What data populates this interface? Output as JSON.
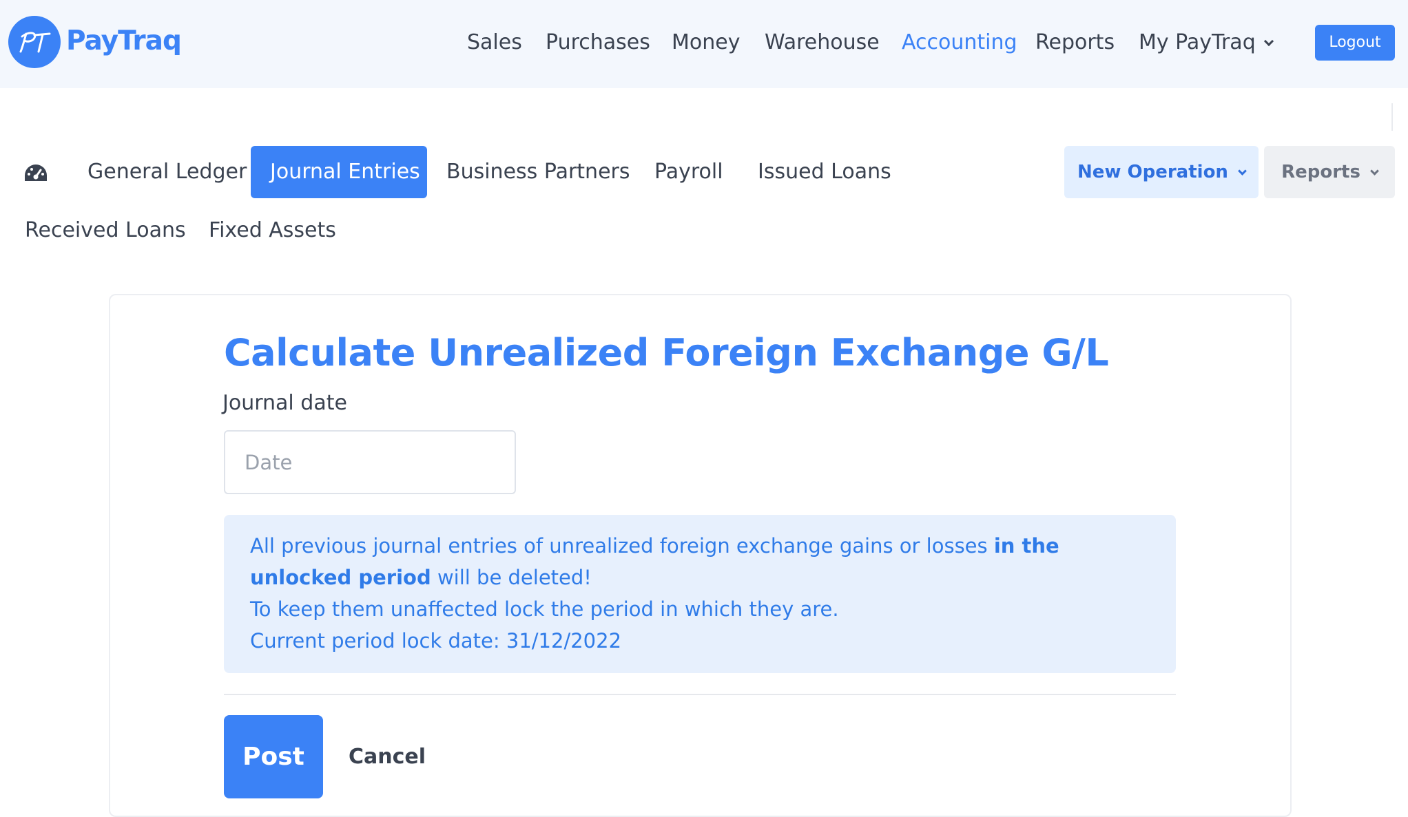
{
  "header": {
    "brand": "PayTraq",
    "logo_mark": "PT",
    "nav": [
      {
        "label": "Sales"
      },
      {
        "label": "Purchases"
      },
      {
        "label": "Money"
      },
      {
        "label": "Warehouse"
      },
      {
        "label": "Accounting",
        "active": true
      },
      {
        "label": "Reports"
      },
      {
        "label": "My PayTraq",
        "dropdown": true
      }
    ],
    "logout_label": "Logout"
  },
  "subnav": {
    "dashboard_icon": "dashboard-gauge-icon",
    "items": [
      {
        "label": "General Ledger"
      },
      {
        "label": "Journal Entries",
        "active": true
      },
      {
        "label": "Business Partners"
      },
      {
        "label": "Payroll"
      },
      {
        "label": "Issued Loans"
      },
      {
        "label": "Received Loans"
      },
      {
        "label": "Fixed Assets"
      }
    ],
    "new_operation_label": "New Operation",
    "reports_label": "Reports"
  },
  "form": {
    "title": "Calculate Unrealized Foreign Exchange G/L",
    "date_label": "Journal date",
    "date_placeholder": "Date",
    "date_value": "",
    "notice": {
      "line1_prefix": "All previous journal entries of unrealized foreign exchange gains or losses ",
      "line1_bold": "in the unlocked period",
      "line1_suffix": " will be deleted!",
      "line2": "To keep them unaffected lock the period in which they are.",
      "line3": "Current period lock date: 31/12/2022"
    },
    "post_label": "Post",
    "cancel_label": "Cancel"
  },
  "colors": {
    "accent": "#3b82f6",
    "notice_bg": "#e7f0fd",
    "topbar_bg": "#f3f7fd"
  }
}
